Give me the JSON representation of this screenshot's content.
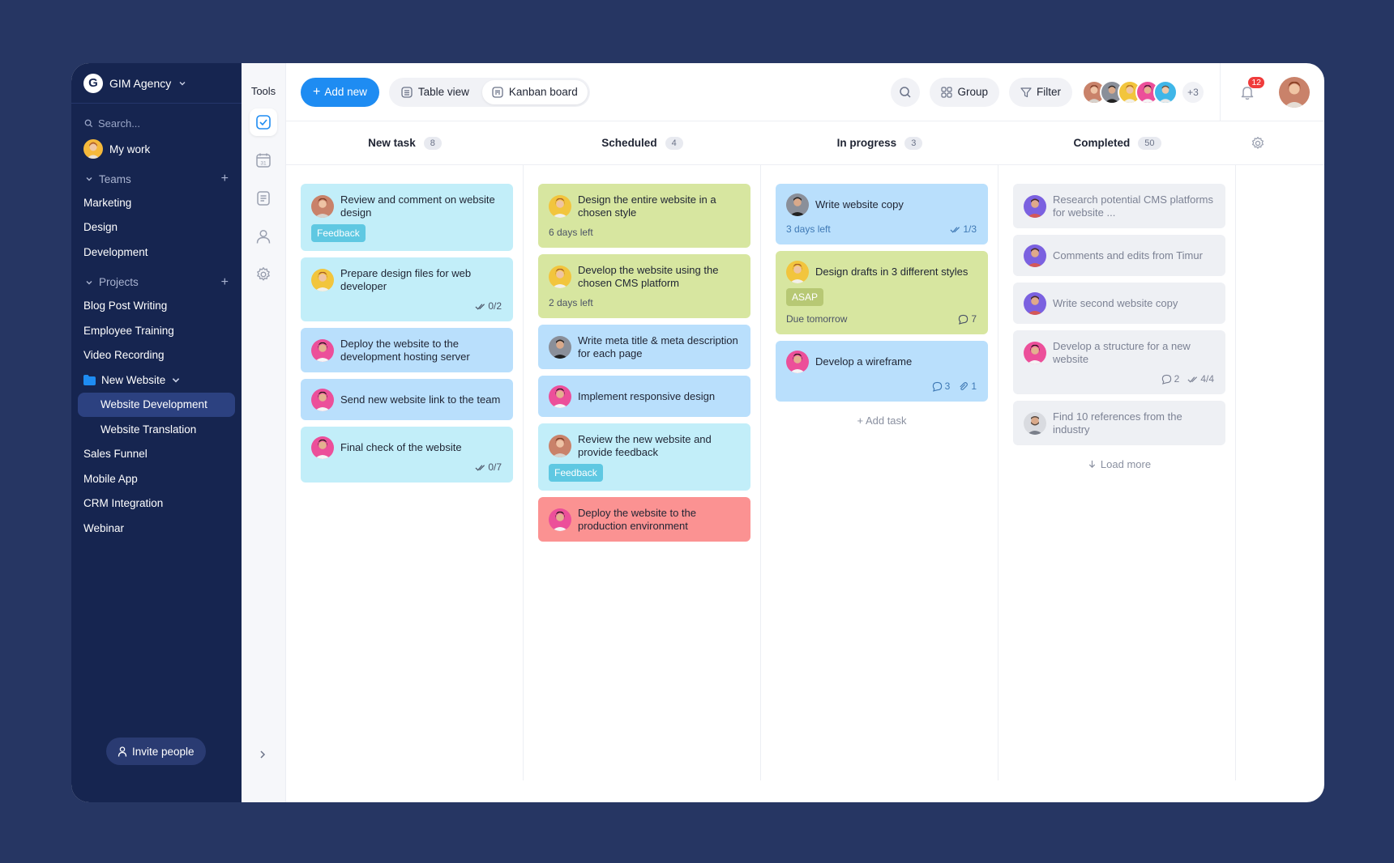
{
  "workspace": {
    "name": "GIM Agency",
    "logo_letter": "G"
  },
  "sidebar": {
    "search_placeholder": "Search...",
    "my_work": "My work",
    "teams_label": "Teams",
    "teams": [
      "Marketing",
      "Design",
      "Development"
    ],
    "projects_label": "Projects",
    "projects": [
      "Blog Post Writing",
      "Employee Training",
      "Video Recording"
    ],
    "new_website": "New Website",
    "subprojects": [
      "Website Development",
      "Website Translation"
    ],
    "projects_after": [
      "Sales Funnel",
      "Mobile App",
      "CRM Integration",
      "Webinar"
    ],
    "invite": "Invite people"
  },
  "tools": {
    "title": "Tools",
    "calendar_day": "31"
  },
  "topbar": {
    "add_new": "Add new",
    "table_view": "Table view",
    "kanban_board": "Kanban board",
    "group": "Group",
    "filter": "Filter",
    "more_members": "+3",
    "notifications": "12"
  },
  "columns": [
    {
      "name": "New task",
      "count": "8",
      "cards": [
        {
          "title": "Review and comment on website design",
          "tag": "Feedback",
          "color": "#c2eef9"
        },
        {
          "title": "Prepare design files for web developer",
          "checks": "0/2",
          "color": "#c2eef9"
        },
        {
          "title": "Deploy the website to the development hosting server",
          "color": "#b9dffc"
        },
        {
          "title": "Send new website link to the team",
          "color": "#b9dffc"
        },
        {
          "title": "Final check of the website",
          "checks": "0/7",
          "color": "#c2eef9"
        }
      ]
    },
    {
      "name": "Scheduled",
      "count": "4",
      "cards": [
        {
          "title": "Design the entire website in a chosen style",
          "due": "6 days left",
          "color": "#d7e6a0"
        },
        {
          "title": "Develop the website using the chosen CMS platform",
          "due": "2 days left",
          "color": "#d7e6a0"
        },
        {
          "title": "Write meta title & meta description for each page",
          "color": "#b9dffc"
        },
        {
          "title": "Implement responsive design",
          "color": "#b9dffc"
        },
        {
          "title": "Review the new website and provide feedback",
          "tag": "Feedback",
          "color": "#c2eef9"
        },
        {
          "title": "Deploy the website to the production environment",
          "color": "#fb9292"
        }
      ]
    },
    {
      "name": "In progress",
      "count": "3",
      "cards": [
        {
          "title": "Write website copy",
          "due": "3 days left",
          "checks": "1/3",
          "color": "#b9dffc"
        },
        {
          "title": "Design drafts in 3 different styles",
          "tag": "ASAP",
          "due": "Due tomorrow",
          "comments": "7",
          "color": "#d7e6a0"
        },
        {
          "title": "Develop a wireframe",
          "comments": "3",
          "attachments": "1",
          "color": "#b9dffc"
        }
      ],
      "add_task": "Add task"
    },
    {
      "name": "Completed",
      "count": "50",
      "cards": [
        {
          "title": "Research potential CMS platforms for website ...",
          "color": "#eef0f4"
        },
        {
          "title": "Comments and edits from Timur",
          "color": "#eef0f4"
        },
        {
          "title": "Write second website copy",
          "color": "#eef0f4"
        },
        {
          "title": "Develop a structure for a new website",
          "comments": "2",
          "checks": "4/4",
          "color": "#eef0f4"
        },
        {
          "title": "Find 10 references from the industry",
          "color": "#eef0f4"
        }
      ],
      "load_more": "Load more"
    }
  ],
  "colors": {
    "accent": "#1e8cf2",
    "sidebar": "#162550",
    "background": "#263663",
    "badge": "#f03b3b"
  }
}
